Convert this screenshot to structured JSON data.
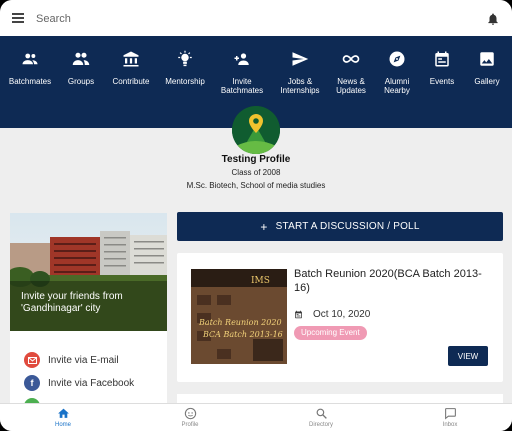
{
  "search": {
    "placeholder": "Search"
  },
  "nav": [
    {
      "icon": "batchmates-icon",
      "label": "Batchmates"
    },
    {
      "icon": "groups-icon",
      "label": "Groups"
    },
    {
      "icon": "contribute-icon",
      "label": "Contribute"
    },
    {
      "icon": "mentorship-icon",
      "label": "Mentorship"
    },
    {
      "icon": "invite-batchmates-icon",
      "label": "Invite\nBatchmates"
    },
    {
      "icon": "jobs-internships-icon",
      "label": "Jobs &\nInternships"
    },
    {
      "icon": "news-updates-icon",
      "label": "News &\nUpdates"
    },
    {
      "icon": "alumni-nearby-icon",
      "label": "Alumni\nNearby"
    },
    {
      "icon": "events-icon",
      "label": "Events"
    },
    {
      "icon": "gallery-icon",
      "label": "Gallery"
    }
  ],
  "profile": {
    "name": "Testing Profile",
    "class": "Class of 2008",
    "degree": "M.Sc. Biotech, School of media studies"
  },
  "invite_card": {
    "text": "Invite your friends from 'Gandhinagar' city",
    "email_label": "Invite via E-mail",
    "facebook_label": "Invite via Facebook"
  },
  "discussion_button": {
    "label": "START A DISCUSSION / POLL"
  },
  "event": {
    "title": "Batch Reunion 2020(BCA Batch 2013-16)",
    "date": "Oct 10, 2020",
    "badge": "Upcoming Event",
    "view_label": "VIEW",
    "image_text": {
      "logo": "IMS",
      "line1": "Batch Reunion 2020",
      "line2": "BCA Batch 2013-16"
    }
  },
  "bottom_nav": [
    {
      "icon": "home-icon",
      "label": "Home",
      "active": true
    },
    {
      "icon": "profile-icon",
      "label": "Profile",
      "active": false
    },
    {
      "icon": "directory-icon",
      "label": "Directory",
      "active": false
    },
    {
      "icon": "inbox-icon",
      "label": "Inbox",
      "active": false
    }
  ],
  "colors": {
    "primary": "#0e2a54",
    "accent": "#1a73c8",
    "badge": "#f09ab4",
    "background": "#eeeeee"
  }
}
